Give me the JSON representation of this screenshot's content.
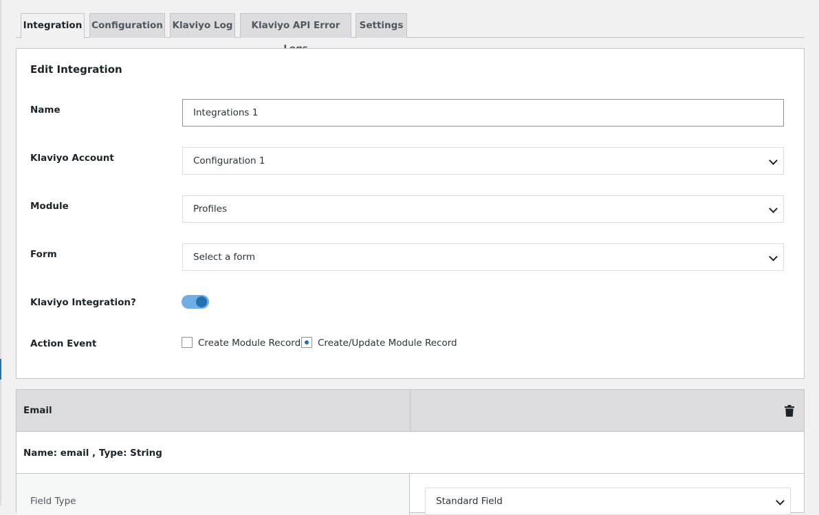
{
  "tabs": [
    {
      "label": "Integration",
      "active": true
    },
    {
      "label": "Configuration",
      "active": false
    },
    {
      "label": "Klaviyo Log",
      "active": false
    },
    {
      "label": "Klaviyo API Error Logs",
      "active": false
    },
    {
      "label": "Settings",
      "active": false
    }
  ],
  "edit": {
    "title": "Edit Integration",
    "name_label": "Name",
    "name_value": "Integrations 1",
    "account_label": "Klaviyo Account",
    "account_value": "Configuration 1",
    "module_label": "Module",
    "module_value": "Profiles",
    "form_label": "Form",
    "form_value": "Select a form",
    "integration_label": "Klaviyo Integration?",
    "integration_enabled": true,
    "action_label": "Action Event",
    "actions": [
      {
        "label": "Create Module Record",
        "checked": false
      },
      {
        "label": "Create/Update Module Record",
        "checked": true
      }
    ]
  },
  "mapping": {
    "field_title": "Email",
    "field_meta": "Name: email , Type: String",
    "field_type_label": "Field Type",
    "field_type_value": "Standard Field"
  },
  "icons": {
    "delete": "trash-icon",
    "dropdown": "chevron-down-icon"
  },
  "colors": {
    "accent": "#2271b1",
    "toggle_track": "#72aee6"
  }
}
